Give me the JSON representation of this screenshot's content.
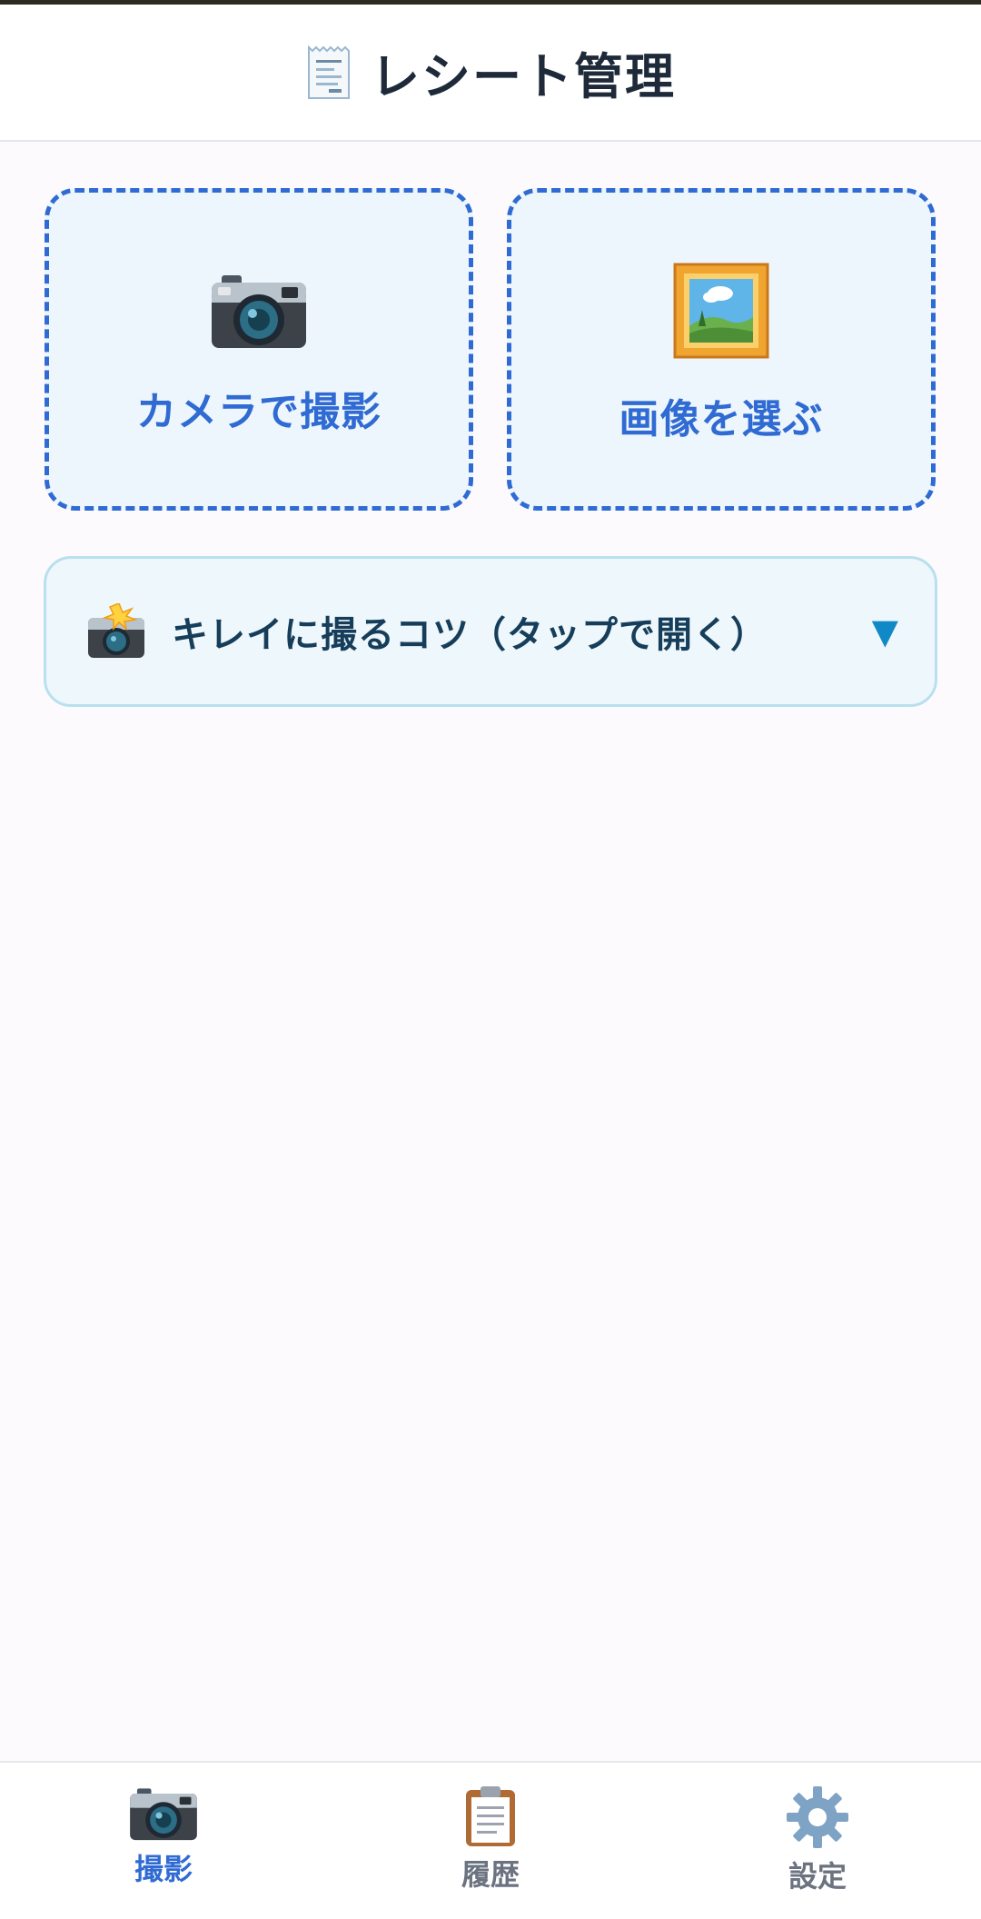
{
  "header": {
    "title": "レシート管理",
    "icon": "receipt-icon"
  },
  "actions": {
    "camera": {
      "label": "カメラで撮影",
      "icon": "camera-icon"
    },
    "gallery": {
      "label": "画像を選ぶ",
      "icon": "framed-picture-icon"
    }
  },
  "tips": {
    "label": "キレイに撮るコツ（タップで開く）",
    "icon": "camera-flash-icon",
    "chevron": "▼"
  },
  "nav": {
    "items": [
      {
        "label": "撮影",
        "icon": "camera-icon",
        "active": true
      },
      {
        "label": "履歴",
        "icon": "clipboard-icon",
        "active": false
      },
      {
        "label": "設定",
        "icon": "gear-icon",
        "active": false
      }
    ]
  },
  "colors": {
    "accent": "#2f6bd3",
    "tips_text": "#163e5a",
    "tips_border": "#b8e0ef",
    "inactive": "#6b7280"
  }
}
